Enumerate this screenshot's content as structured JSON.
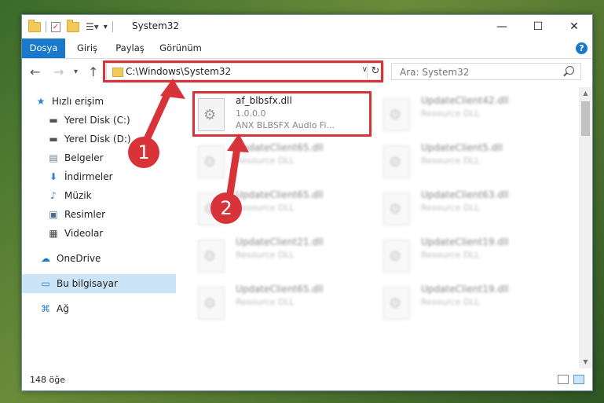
{
  "window": {
    "title": "System32",
    "controls": {
      "minimize": "—",
      "maximize": "☐",
      "close": "✕"
    }
  },
  "ribbon": {
    "tabs": [
      {
        "label": "Dosya"
      },
      {
        "label": "Giriş"
      },
      {
        "label": "Paylaş"
      },
      {
        "label": "Görünüm"
      }
    ],
    "help": "?"
  },
  "nav": {
    "address": "C:\\Windows\\System32",
    "search_placeholder": "Ara: System32"
  },
  "sidebar": {
    "items": [
      {
        "label": "Hızlı erişim",
        "icon": "★",
        "pinned": false
      },
      {
        "label": "Yerel Disk (C:)",
        "icon": "▬",
        "pinned": true
      },
      {
        "label": "Yerel Disk (D:)",
        "icon": "▬",
        "pinned": true
      },
      {
        "label": "Belgeler",
        "icon": "▤",
        "pinned": true
      },
      {
        "label": "İndirmeler",
        "icon": "⬇",
        "pinned": true
      },
      {
        "label": "Müzik",
        "icon": "♪",
        "pinned": true
      },
      {
        "label": "Resimler",
        "icon": "▣",
        "pinned": true
      },
      {
        "label": "Videolar",
        "icon": "▦",
        "pinned": true
      },
      {
        "label": "OneDrive",
        "icon": "☁",
        "pinned": false
      },
      {
        "label": "Bu bilgisayar",
        "icon": "▭",
        "pinned": false,
        "selected": true
      },
      {
        "label": "Ağ",
        "icon": "⌘",
        "pinned": false
      }
    ]
  },
  "files": {
    "highlighted": {
      "name": "af_blbsfx.dll",
      "version": "1.0.0.0",
      "description": "ANX BLBSFX Audio Fi..."
    },
    "others": [
      {
        "name": "UpdateClient42.dll",
        "type": "Resource DLL"
      },
      {
        "name": "UpdateClient65.dll",
        "type": "Resource DLL"
      },
      {
        "name": "UpdateClient5.dll",
        "type": "Resource DLL"
      },
      {
        "name": "UpdateClient65.dll",
        "type": "Resource DLL"
      },
      {
        "name": "UpdateClient63.dll",
        "type": "Resource DLL"
      },
      {
        "name": "UpdateClient21.dll",
        "type": "Resource DLL"
      },
      {
        "name": "UpdateClient19.dll",
        "type": "Resource DLL"
      },
      {
        "name": "UpdateClient65.dll",
        "type": "Resource DLL"
      },
      {
        "name": "UpdateClient19.dll",
        "type": "Resource DLL"
      }
    ]
  },
  "status": {
    "item_count": "148 öğe"
  },
  "annotations": {
    "badge_1": "1",
    "badge_2": "2",
    "color": "#d9333a"
  }
}
